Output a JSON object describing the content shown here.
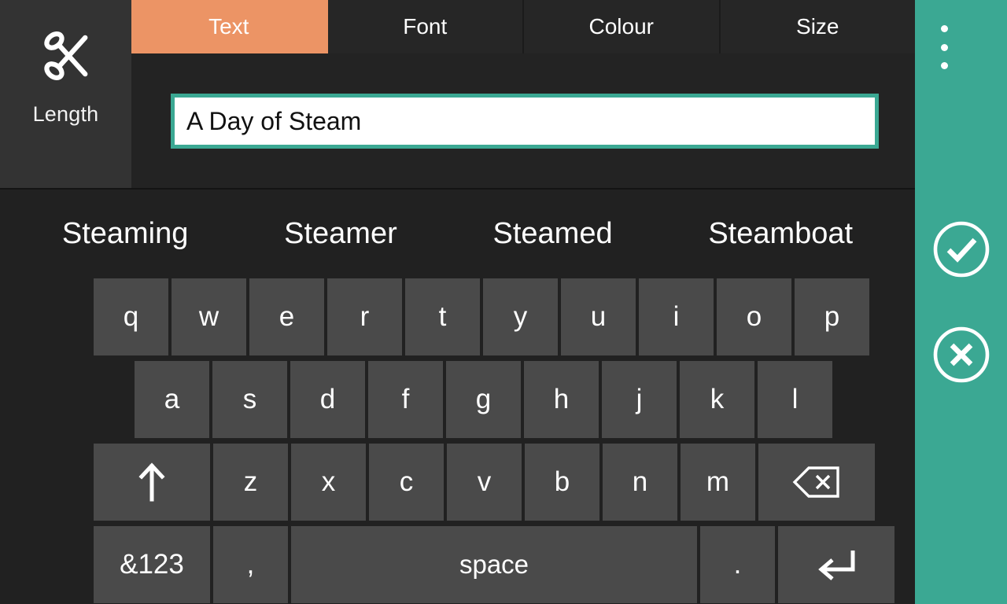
{
  "colors": {
    "accent_orange": "#ec9465",
    "accent_teal": "#3ba893",
    "panel_dark": "#232323",
    "panel_left": "#333333",
    "keyboard_bg": "#212121",
    "key_bg": "#4a4a4a",
    "text_light": "#ffffff",
    "field_bg": "#ffffff",
    "field_text": "#111111"
  },
  "left_pane": {
    "icon": "scissors-icon",
    "label": "Length"
  },
  "tabs": [
    {
      "label": "Text",
      "active": true
    },
    {
      "label": "Font",
      "active": false
    },
    {
      "label": "Colour",
      "active": false
    },
    {
      "label": "Size",
      "active": false
    }
  ],
  "text_field": {
    "value": "A Day of Steam",
    "placeholder": "",
    "focused": true
  },
  "suggestions": [
    "Steaming",
    "Steamer",
    "Steamed",
    "Steamboat"
  ],
  "keyboard": {
    "row1": [
      "q",
      "w",
      "e",
      "r",
      "t",
      "y",
      "u",
      "i",
      "o",
      "p"
    ],
    "row2": [
      "a",
      "s",
      "d",
      "f",
      "g",
      "h",
      "j",
      "k",
      "l"
    ],
    "row3_letters": [
      "z",
      "x",
      "c",
      "v",
      "b",
      "n",
      "m"
    ],
    "shift_key": {
      "label": "",
      "icon": "shift-arrow-up-icon"
    },
    "backspace_key": {
      "label": "",
      "icon": "backspace-icon"
    },
    "row4": {
      "numbers_key": "&123",
      "comma_key": ",",
      "space_key": "space",
      "period_key": ".",
      "enter_key": {
        "label": "",
        "icon": "enter-return-icon"
      }
    }
  },
  "rail": {
    "menu": {
      "icon": "overflow-menu-dots-icon"
    },
    "confirm": {
      "icon": "check-circle-icon"
    },
    "cancel": {
      "icon": "close-circle-icon"
    }
  }
}
